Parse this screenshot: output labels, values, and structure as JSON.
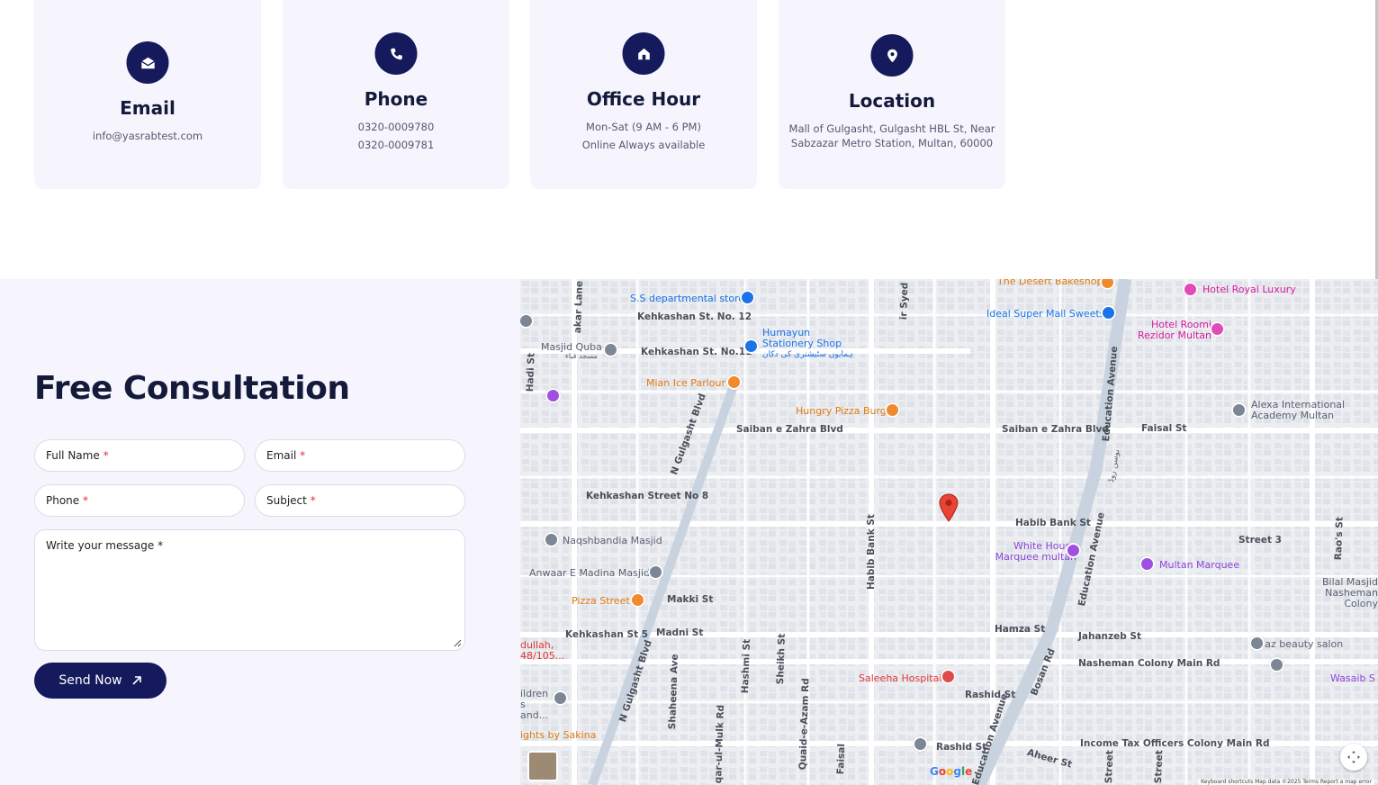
{
  "cards": [
    {
      "title": "Email",
      "lines": [
        "info@yasrabtest.com"
      ]
    },
    {
      "title": "Phone",
      "lines": [
        "0320-0009780",
        "0320-0009781"
      ]
    },
    {
      "title": "Office Hour",
      "lines": [
        "Mon-Sat (9 AM - 6 PM)",
        "Online Always available"
      ]
    },
    {
      "title": "Location",
      "lines": [
        "Mall of Gulgasht, Gulgasht HBL St, Near",
        "Sabzazar Metro Station, Multan, 60000"
      ]
    }
  ],
  "form": {
    "title": "Free Consultation",
    "full_name": "Full Name",
    "email": "Email",
    "phone": "Phone",
    "subject": "Subject",
    "message": "Write your message",
    "required_mark": "*",
    "send": "Send Now"
  },
  "map": {
    "streets": {
      "s1": "Kehkashan St. No. 12",
      "s2": "Kehkashan St. No.11",
      "s3": "Saiban e Zahra Blvd",
      "s4": "Saiban e Zahra Blvd",
      "s5": "Faisal St",
      "s6": "Kehkashan Street No 8",
      "s7": "N Gulgasht Blvd",
      "s8": "Habib Bank St",
      "s9": "Habib Bank St",
      "s10": "Street 3",
      "s11": "Makki St",
      "s12": "Madni St",
      "s13": "Kehkashan St 5",
      "s14": "Hamza St",
      "s15": "Jahanzeb St",
      "s16": "Nasheman Colony Main Rd",
      "s17": "Rashid St",
      "s18": "Rashid St",
      "s19": "Income Tax Officers Colony Main Rd",
      "s20": "Education Avenue",
      "s21": "Education Avenue",
      "s22": "Bosan Rd",
      "s23": "N Gulgasht Blvd",
      "s24": "Shaheena Ave",
      "s25": "Hashmi St",
      "s26": "Sheikh St",
      "s27": "Quaid-e-Azam Rd",
      "s28": "Aheer St",
      "s29": "Rao's St",
      "s30": "Hadi St",
      "s31": "akar Lane 1",
      "s32": "ir Syed St",
      "s33": "Faisal",
      "s34": "qar-ul-Mulk Rd",
      "s35": "Street",
      "s36": "Street",
      "s37": "Education Avenue"
    },
    "pois": {
      "p1": "S.S departmental store",
      "p2": "Humayun Stationery Shop",
      "p2b": "ہمایوں سٹیشنری کی دکان",
      "p3": "Masjid Quba",
      "p3b": "مسجد قباء",
      "p4": "Mian Ice Parlour",
      "p5": "Hungry Pizza Burg",
      "p6": "The Desert Bakeshop",
      "p7": "Ideal Super Mall Sweets",
      "p8": "Hotel Royal Luxury",
      "p9": "Hotel Roomi Rezidor Multan",
      "p10": "Alexa International Academy Multan",
      "p11": "Naqshbandia Masjid",
      "p12": "Anwaar E Madina Masjid",
      "p13": "Pizza Street",
      "p14": "White House Marquee multan",
      "p15": "Multan Marquee",
      "p16": "Bilal Masjid Nasheman Colony",
      "p17": "Naz beauty salon",
      "p18": "Saleeha Hospital",
      "p19": "Wasaib S",
      "p20": "dullah, 48/105...",
      "p21": "ildren s and...",
      "p22": "ights by Sakina",
      "p23": "بوسن روڈ"
    },
    "google": "Google",
    "attribution": "Keyboard shortcuts   Map data ©2025   Terms   Report a map error"
  },
  "colors": {
    "navy": "#141a5c",
    "card_bg": "#f6f4fd",
    "required": "#e0303a"
  }
}
